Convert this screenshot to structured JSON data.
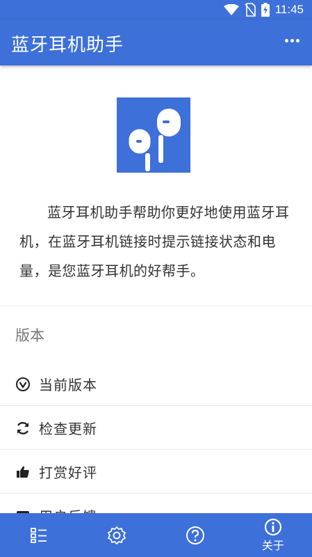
{
  "status_bar": {
    "time": "11:45",
    "icons": [
      "wifi-icon",
      "no-sim-icon",
      "battery-charging-icon"
    ]
  },
  "app_bar": {
    "title": "蓝牙耳机助手",
    "more_icon": "more-horizontal-icon"
  },
  "about": {
    "logo_icon": "earphones-icon",
    "description": "蓝牙耳机助手帮助你更好地使用蓝牙耳机，在蓝牙耳机链接时提示链接状态和电量，是您蓝牙耳机的好帮手。"
  },
  "version_section": {
    "title": "版本",
    "items": [
      {
        "label": "当前版本",
        "icon": "check-circle-icon"
      },
      {
        "label": "检查更新",
        "icon": "refresh-icon"
      },
      {
        "label": "打赏好评",
        "icon": "thumbs-up-icon"
      },
      {
        "label": "用户反馈",
        "icon": "chat-icon"
      }
    ]
  },
  "bottom_nav": {
    "items": [
      {
        "label": "",
        "icon": "list-icon"
      },
      {
        "label": "",
        "icon": "settings-icon"
      },
      {
        "label": "",
        "icon": "help-icon"
      },
      {
        "label": "关于",
        "icon": "info-icon"
      }
    ]
  },
  "colors": {
    "primary": "#3d70d9",
    "background": "#ffffff",
    "text": "#333333",
    "section_title": "#777777"
  }
}
